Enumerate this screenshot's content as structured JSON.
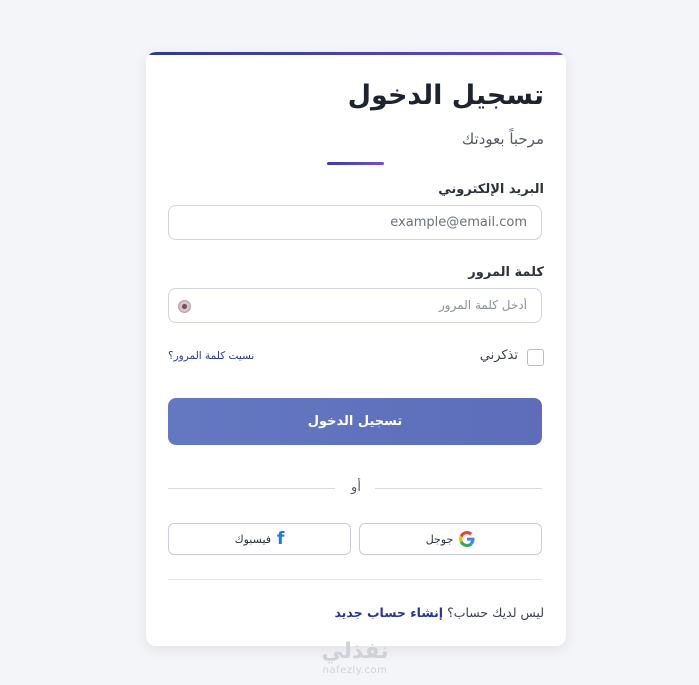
{
  "login": {
    "title": "تسجيل الدخول",
    "subtitle": "مرحباً بعودتك",
    "email": {
      "label": "البريد الإلكتروني",
      "placeholder": "example@email.com",
      "value": ""
    },
    "password": {
      "label": "كلمة المرور",
      "placeholder": "أدخل كلمة المرور",
      "value": "",
      "toggle_icon": "eye-icon"
    },
    "remember_label": "تذكرني",
    "remember_checked": false,
    "forgot_link": "نسيت كلمة المرور؟",
    "submit_label": "تسجيل الدخول",
    "divider_text": "أو",
    "social": {
      "google": {
        "label": "جوجل",
        "icon": "google-icon"
      },
      "facebook": {
        "label": "فيسبوك",
        "icon": "facebook-icon"
      }
    },
    "signup_prompt": "ليس لديك حساب؟",
    "signup_link": "إنشاء حساب جديد"
  },
  "watermark": {
    "arabic": "نفذلي",
    "latin": "nafezly.com"
  },
  "colors": {
    "accent": "#5f70bd",
    "link": "#243894",
    "facebook": "#1877f2",
    "background": "#f4f5f8"
  }
}
